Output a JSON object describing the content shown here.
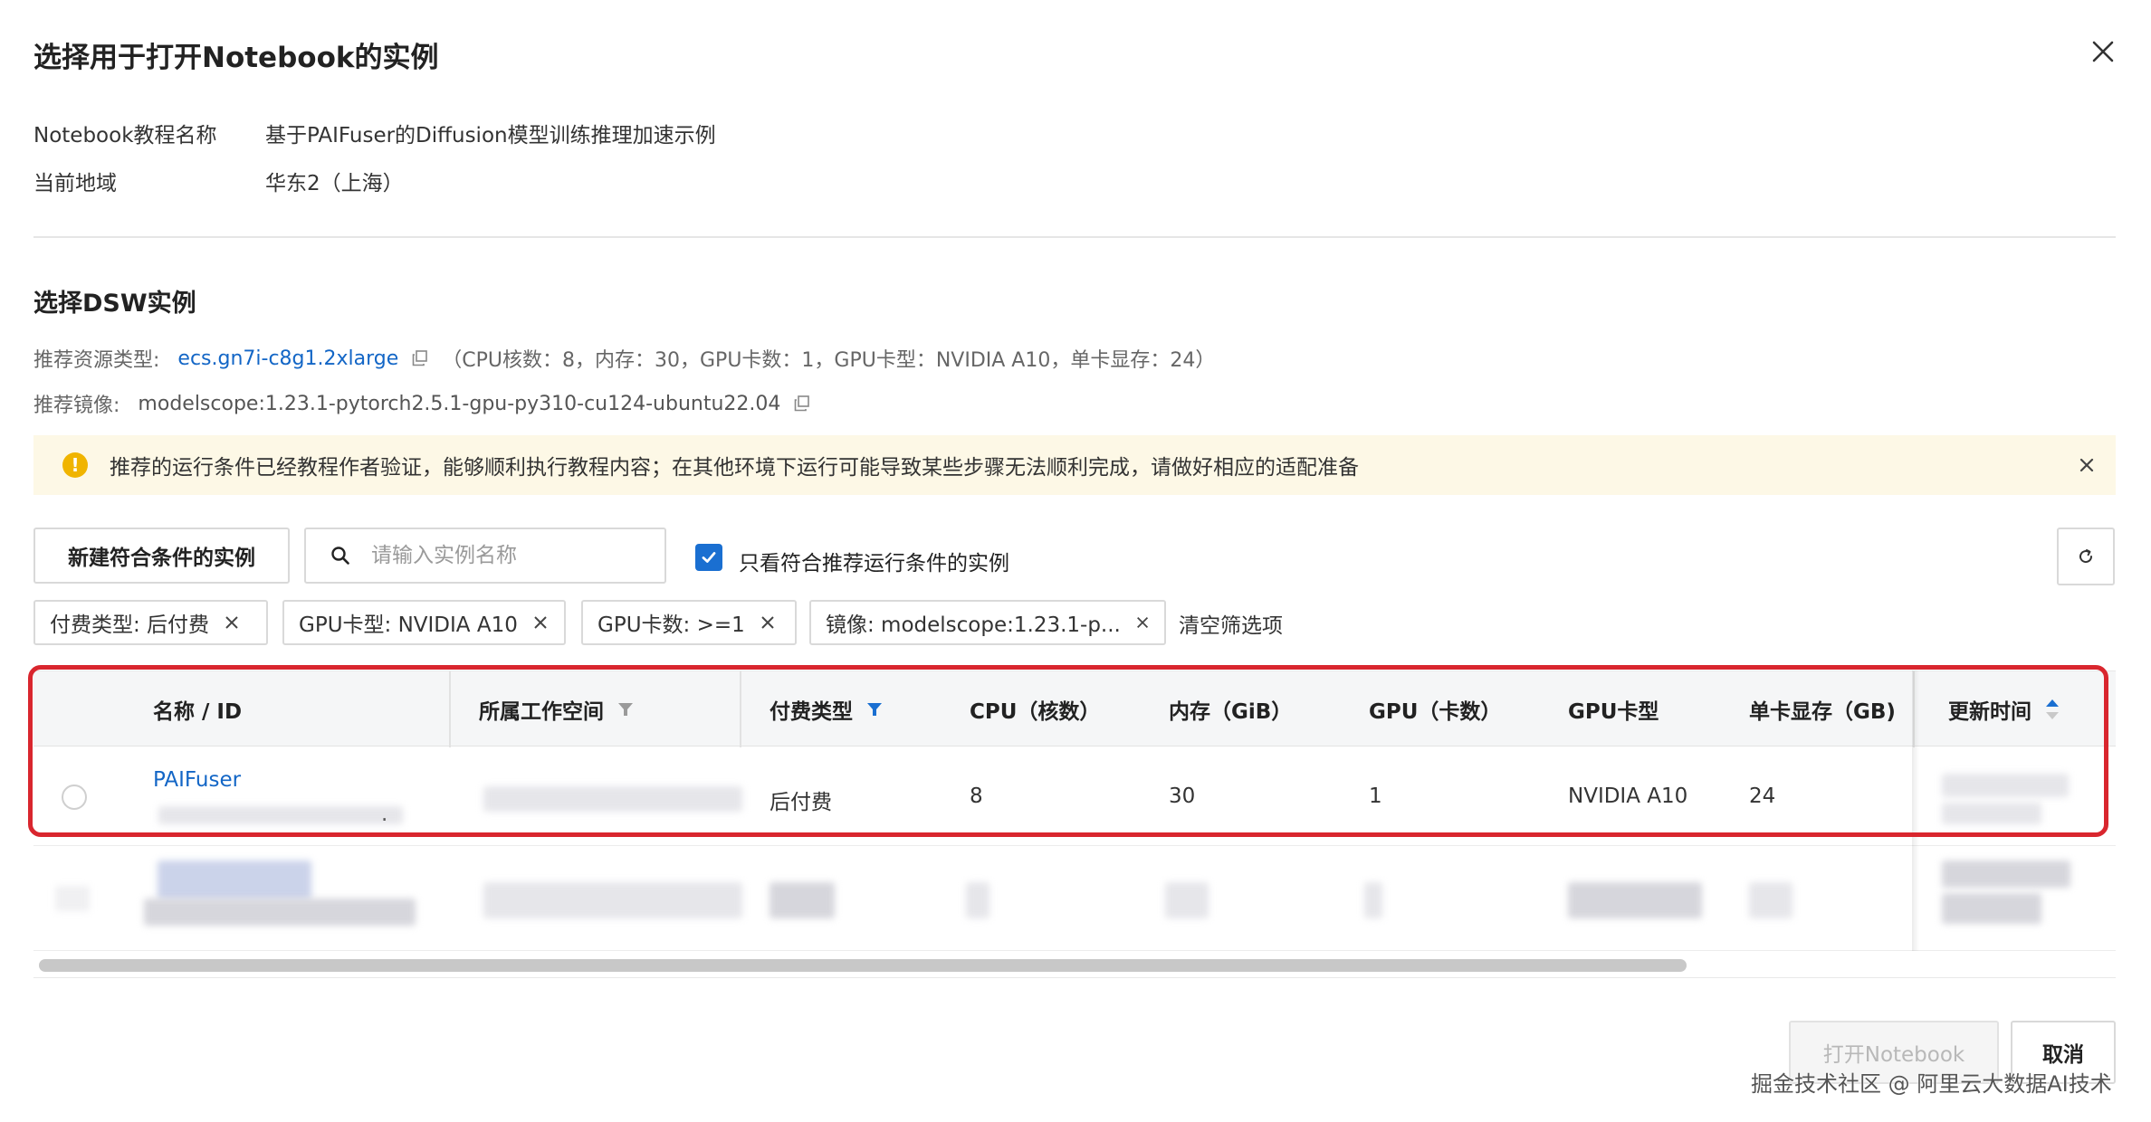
{
  "dialog": {
    "title": "选择用于打开Notebook的实例"
  },
  "info": {
    "tutorial_label": "Notebook教程名称",
    "tutorial_value": "基于PAIFuser的Diffusion模型训练推理加速示例",
    "region_label": "当前地域",
    "region_value": "华东2（上海）"
  },
  "dsw": {
    "section_title": "选择DSW实例",
    "resource_label": "推荐资源类型:",
    "resource_value": "ecs.gn7i-c8g1.2xlarge",
    "resource_spec": "（CPU核数：8，内存：30，GPU卡数：1，GPU卡型：NVIDIA A10，单卡显存：24）",
    "image_label": "推荐镜像:",
    "image_value": "modelscope:1.23.1-pytorch2.5.1-gpu-py310-cu124-ubuntu22.04"
  },
  "alert": {
    "icon": "!",
    "text": "推荐的运行条件已经教程作者验证，能够顺利执行教程内容；在其他环境下运行可能导致某些步骤无法顺利完成，请做好相应的适配准备"
  },
  "toolbar": {
    "create_label": "新建符合条件的实例",
    "search_placeholder": "请输入实例名称",
    "checkbox_label": "只看符合推荐运行条件的实例",
    "checkbox_checked": true
  },
  "filters": {
    "tags": [
      "付费类型: 后付费",
      "GPU卡型: NVIDIA A10",
      "GPU卡数: >=1",
      "镜像: modelscope:1.23.1-p..."
    ],
    "clear_label": "清空筛选项"
  },
  "table": {
    "headers": [
      "名称 / ID",
      "所属工作空间",
      "付费类型",
      "CPU（核数）",
      "内存（GiB）",
      "GPU（卡数）",
      "GPU卡型",
      "单卡显存（GB)",
      "更新时间"
    ],
    "rows": [
      {
        "name": "PAIFuser",
        "id_suffix": ".",
        "billing": "后付费",
        "cpu": "8",
        "memory": "30",
        "gpu": "1",
        "gpu_type": "NVIDIA A10",
        "gpu_mem": "24"
      }
    ]
  },
  "footer": {
    "open_label": "打开Notebook",
    "cancel_label": "取消",
    "watermark": "掘金技术社区 @ 阿里云大数据AI技术"
  },
  "colors": {
    "accent": "#1a6fd1",
    "link": "#1366c6",
    "highlight_border": "#d9262e",
    "alert_bg": "#fdf8e6",
    "warning_icon": "#f0b400"
  }
}
